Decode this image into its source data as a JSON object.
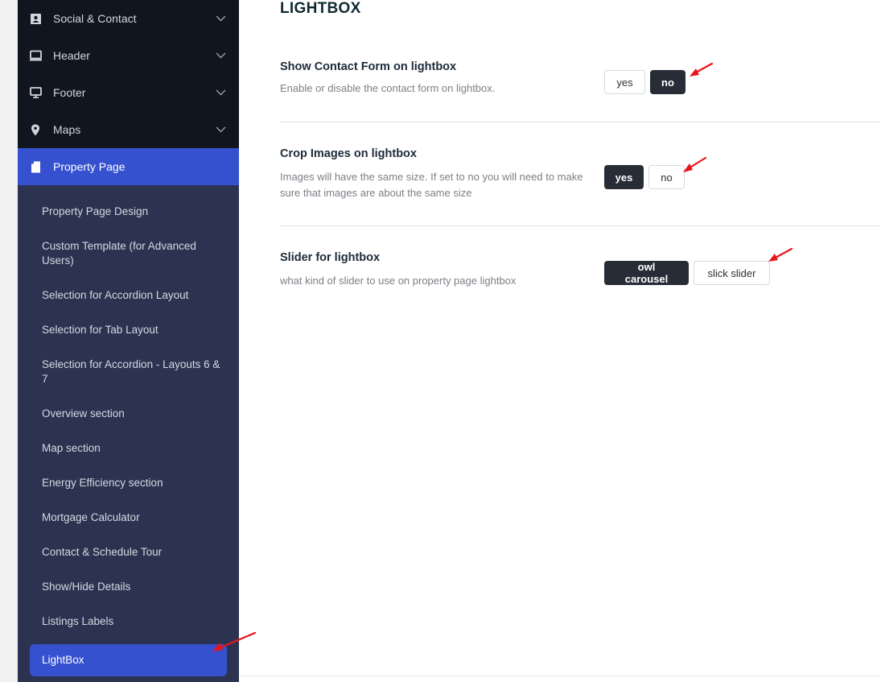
{
  "sidebar": {
    "top_items": [
      {
        "label": "Social & Contact",
        "icon": "contact-card-icon"
      },
      {
        "label": "Header",
        "icon": "monitor-icon"
      },
      {
        "label": "Footer",
        "icon": "desktop-icon"
      },
      {
        "label": "Maps",
        "icon": "map-pin-icon"
      }
    ],
    "active_item": {
      "label": "Property Page",
      "icon": "document-icon"
    },
    "sub_items": [
      "Property Page Design",
      "Custom Template (for Advanced Users)",
      "Selection for Accordion Layout",
      "Selection for Tab Layout",
      "Selection for Accordion - Layouts 6 & 7",
      "Overview section",
      "Map section",
      "Energy Efficiency section",
      "Mortgage Calculator",
      "Contact & Schedule Tour",
      "Show/Hide Details",
      "Listings Labels"
    ],
    "active_sub_item": "LightBox"
  },
  "main": {
    "title": "LIGHTBOX",
    "options": [
      {
        "title": "Show Contact Form on lightbox",
        "description": "Enable or disable the contact form on lightbox.",
        "buttons": [
          "yes",
          "no"
        ],
        "selected": "no"
      },
      {
        "title": "Crop Images on lightbox",
        "description": "Images will have the same size. If set to no you will need to make sure that images are about the same size",
        "buttons": [
          "yes",
          "no"
        ],
        "selected": "yes"
      },
      {
        "title": "Slider for lightbox",
        "description": "what kind of slider to use on property page lightbox",
        "buttons": [
          "owl carousel",
          "slick slider"
        ],
        "selected": "owl carousel"
      }
    ]
  },
  "colors": {
    "sidebar_bg": "#2c3350",
    "sidebar_top_bg": "#10151f",
    "accent": "#3551cf",
    "selected_button": "#272c36",
    "annotation_arrow": "#e8141b"
  }
}
